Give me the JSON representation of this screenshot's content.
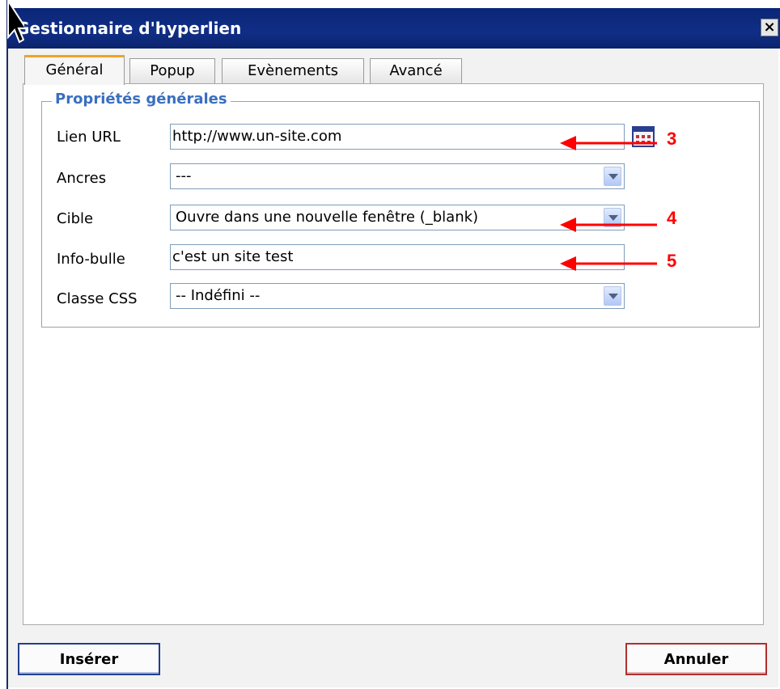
{
  "window": {
    "title": "Gestionnaire d'hyperlien",
    "close_label": "×"
  },
  "tabs": [
    {
      "label": "Général",
      "active": true
    },
    {
      "label": "Popup",
      "active": false
    },
    {
      "label": "Evènements",
      "active": false
    },
    {
      "label": "Avancé",
      "active": false
    }
  ],
  "fieldset": {
    "legend": "Propriétés générales",
    "rows": {
      "url": {
        "label": "Lien URL",
        "value": "http://www.un-site.com"
      },
      "anchors": {
        "label": "Ancres",
        "value": "---"
      },
      "target": {
        "label": "Cible",
        "value": "Ouvre dans une nouvelle fenêtre (_blank)"
      },
      "tooltip": {
        "label": "Info-bulle",
        "value": "c'est un site test"
      },
      "css_class": {
        "label": "Classe CSS",
        "value": "-- Indéfini --"
      }
    }
  },
  "buttons": {
    "insert": "Insérer",
    "cancel": "Annuler"
  },
  "annotations": [
    "3",
    "4",
    "5"
  ],
  "colors": {
    "titlebar": "#0a2677",
    "legend": "#3a6fbf",
    "annotation": "#ff0000",
    "active_tab": "#f0a325"
  }
}
